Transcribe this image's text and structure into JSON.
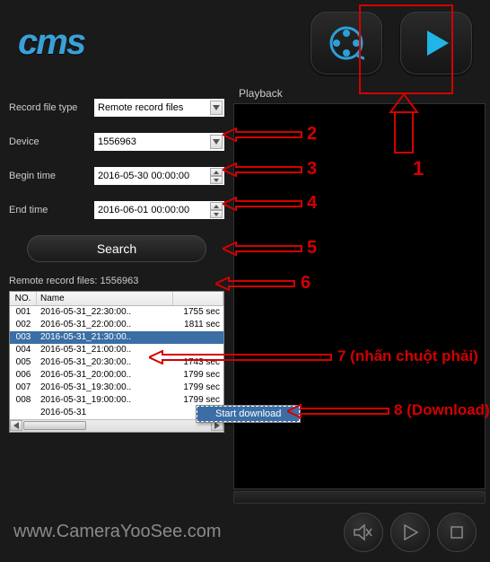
{
  "logo_text": "cms",
  "playback_label": "Playback",
  "form": {
    "record_file_type": {
      "label": "Record file type",
      "value": "Remote record files"
    },
    "device": {
      "label": "Device",
      "value": "1556963"
    },
    "begin_time": {
      "label": "Begin time",
      "value": "2016-05-30 00:00:00"
    },
    "end_time": {
      "label": "End time",
      "value": "2016-06-01 00:00:00"
    }
  },
  "search_label": "Search",
  "remote_label": "Remote record files: 1556963",
  "list": {
    "headers": {
      "no": "NO.",
      "name": "Name",
      "dur": ""
    },
    "rows": [
      {
        "no": "001",
        "name": "2016-05-31_22:30:00..",
        "dur": "1755 sec"
      },
      {
        "no": "002",
        "name": "2016-05-31_22:00:00..",
        "dur": "1811 sec"
      },
      {
        "no": "003",
        "name": "2016-05-31_21:30:00..",
        "dur": "",
        "selected": true
      },
      {
        "no": "004",
        "name": "2016-05-31_21:00:00..",
        "dur": ""
      },
      {
        "no": "005",
        "name": "2016-05-31_20:30:00..",
        "dur": "1743 sec"
      },
      {
        "no": "006",
        "name": "2016-05-31_20:00:00..",
        "dur": "1799 sec"
      },
      {
        "no": "007",
        "name": "2016-05-31_19:30:00..",
        "dur": "1799 sec"
      },
      {
        "no": "008",
        "name": "2016-05-31_19:00:00..",
        "dur": "1799 sec"
      },
      {
        "no": "",
        "name": "2016-05-31",
        "dur": ""
      }
    ]
  },
  "context_menu": {
    "start_download": "Start download"
  },
  "watermark": "www.CameraYooSee.com",
  "annotations": {
    "n1": "1",
    "n2": "2",
    "n3": "3",
    "n4": "4",
    "n5": "5",
    "n6": "6",
    "n7": "7 (nhấn chuột phải)",
    "n8": "8 (Download)"
  }
}
